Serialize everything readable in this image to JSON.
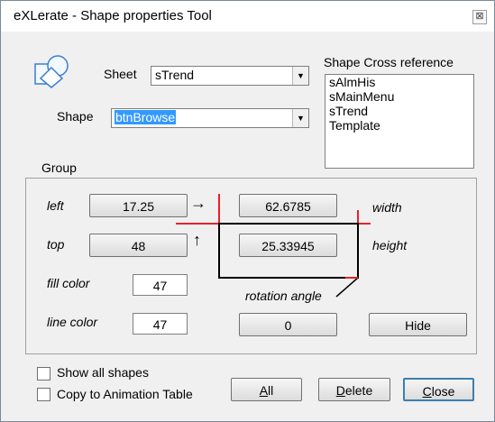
{
  "window": {
    "title": "eXLerate - Shape properties Tool",
    "close_glyph": "⊠"
  },
  "sheet": {
    "label": "Sheet",
    "value": "sTrend"
  },
  "shape": {
    "label": "Shape",
    "value": "btnBrowse"
  },
  "cross_reference": {
    "label": "Shape Cross reference",
    "items": [
      "sAlmHis",
      "sMainMenu",
      "sTrend",
      "Template"
    ]
  },
  "group": {
    "label": "Group",
    "left_label": "left",
    "left_value": "17.25",
    "top_label": "top",
    "top_value": "48",
    "width_label": "width",
    "width_value": "62.6785",
    "height_label": "height",
    "height_value": "25.33945",
    "fill_color_label": "fill color",
    "fill_color_value": "47",
    "line_color_label": "line color",
    "line_color_value": "47",
    "rotation_label": "rotation angle",
    "rotation_value": "0",
    "hide_label": "Hide",
    "arrow_right": "→",
    "arrow_up": "↑"
  },
  "options": {
    "show_all_shapes": "Show all shapes",
    "copy_to_animation": "Copy to Animation Table"
  },
  "buttons": {
    "all": {
      "ul": "A",
      "rest": "ll"
    },
    "delete": {
      "ul": "D",
      "rest": "elete"
    },
    "close": {
      "ul": "C",
      "rest": "lose"
    }
  },
  "colors": {
    "accent_red": "#e8202a",
    "selection": "#3399ff"
  }
}
